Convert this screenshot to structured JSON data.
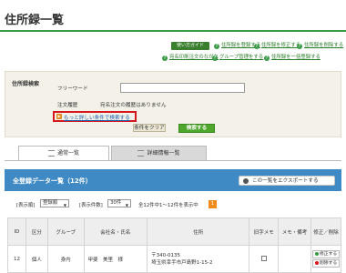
{
  "page": {
    "title": "住所録一覧"
  },
  "guide": {
    "badge": "使い方ガイド",
    "links": [
      "住所録を登録する",
      "住所録を修正する",
      "住所録を削除する",
      "宛名印刷注文のながれ",
      "グループ管理をする",
      "住所録を一括登録する"
    ]
  },
  "search": {
    "label": "住所録検索",
    "freeword_label": "フリーワード",
    "freeword_value": "",
    "history_label": "注文履歴",
    "history_text": "宛名注文の履歴はありません",
    "advanced_link": "もっと詳しい条件で検索する",
    "clear_button": "条件をクリア",
    "search_button": "検索する"
  },
  "tabs": [
    {
      "label": "通常一覧"
    },
    {
      "label": "詳細情報一覧"
    }
  ],
  "list": {
    "title": "全登録データ一覧（12件）",
    "export_button": "この一覧をエクスポートする",
    "sort_label": "[表示順]",
    "sort_value": "登録順",
    "per_page_label": "[表示件数]",
    "per_page_value": "30件",
    "count_text": "全12件中1～12件を表示中",
    "page_number": "1"
  },
  "table": {
    "headers": [
      "ID",
      "区分",
      "グループ",
      "会社名・氏名",
      "住所",
      "旧字メモ",
      "メモ・備考",
      "修正／削除"
    ],
    "rows": [
      {
        "id": "12",
        "category": "個人",
        "group": "身内",
        "name": "甲斐　美里　様",
        "zip": "〒340-0135",
        "address": "埼玉県幸手市戸島野1-15-2",
        "old_char_memo": "",
        "memo": "",
        "edit": "修正する",
        "delete": "削除する"
      }
    ]
  }
}
